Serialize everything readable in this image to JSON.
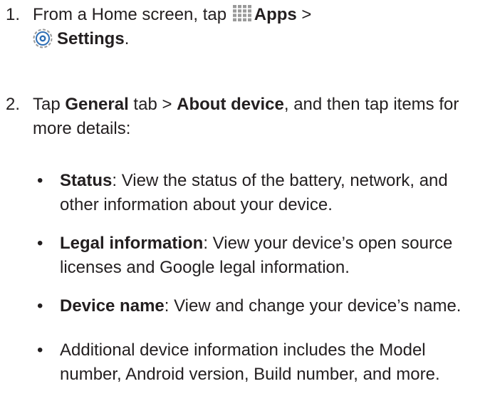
{
  "steps": [
    {
      "number": "1.",
      "t1": "From a Home screen, tap ",
      "apps_icon": "apps-grid-icon",
      "apps_label": "Apps",
      "t2": " >",
      "settings_icon": "settings-gear-icon",
      "settings_label": "Settings",
      "t3": "."
    },
    {
      "number": "2.",
      "t1": "Tap ",
      "general": "General",
      "t2": " tab > ",
      "about": "About device",
      "t3": ", and then tap items for more details:"
    }
  ],
  "bullets": [
    {
      "dot": "•",
      "term": "Status",
      "desc": ": View the status of the battery, network, and other information about your device."
    },
    {
      "dot": "•",
      "term": "Legal information",
      "desc": ": View your device’s open source licenses and Google legal information."
    },
    {
      "dot": "•",
      "term": "Device name",
      "desc": ": View and change your device’s name."
    },
    {
      "dot": "•",
      "text": "Additional device information includes the Model number, Android version, Build number, and more."
    }
  ],
  "colors": {
    "text": "#231f20",
    "icon_gray": "#9a9a9a",
    "settings_blue": "#2f6fb5"
  }
}
